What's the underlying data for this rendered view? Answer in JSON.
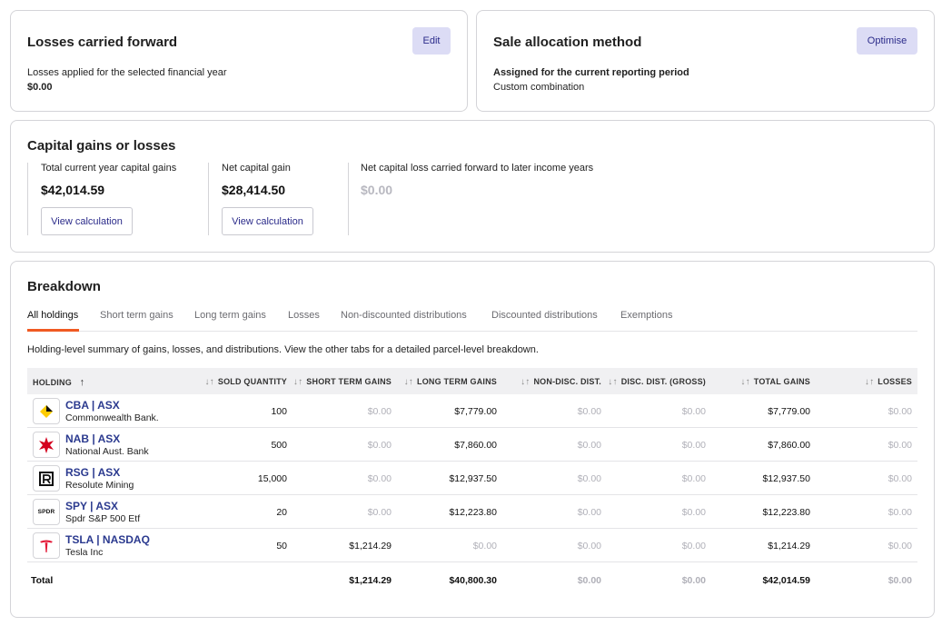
{
  "losses_card": {
    "title": "Losses carried forward",
    "edit_label": "Edit",
    "label": "Losses applied for the selected financial year",
    "value": "$0.00"
  },
  "allocation_card": {
    "title": "Sale allocation method",
    "optimise_label": "Optimise",
    "label": "Assigned for the current reporting period",
    "value": "Custom combination"
  },
  "capital_gains": {
    "title": "Capital gains or losses",
    "total": {
      "label": "Total current year capital gains",
      "value": "$42,014.59",
      "button": "View calculation"
    },
    "net": {
      "label": "Net capital gain",
      "value": "$28,414.50",
      "button": "View calculation"
    },
    "carried": {
      "label": "Net capital loss carried forward to later income years",
      "value": "$0.00"
    }
  },
  "breakdown": {
    "title": "Breakdown",
    "tabs": [
      "All holdings",
      "Short term gains",
      "Long term gains",
      "Losses",
      "Non-discounted distributions",
      "Discounted distributions",
      "Exemptions"
    ],
    "description": "Holding-level summary of gains, losses, and distributions. View the other tabs for a detailed parcel-level breakdown.",
    "columns": [
      "HOLDING",
      "SOLD QUANTITY",
      "SHORT TERM GAINS",
      "LONG TERM GAINS",
      "NON-DISC. DIST.",
      "DISC. DIST. (GROSS)",
      "TOTAL GAINS",
      "LOSSES"
    ],
    "sort_icons": {
      "holding": "↑",
      "other": "↓↑"
    },
    "rows": [
      {
        "ticker": "CBA | ASX",
        "name": "Commonwealth Bank.",
        "logo": "cba-logo",
        "qty": "100",
        "short": "$0.00",
        "long": "$7,779.00",
        "nondisc": "$0.00",
        "disc": "$0.00",
        "total": "$7,779.00",
        "losses": "$0.00"
      },
      {
        "ticker": "NAB | ASX",
        "name": "National Aust. Bank",
        "logo": "nab-logo",
        "qty": "500",
        "short": "$0.00",
        "long": "$7,860.00",
        "nondisc": "$0.00",
        "disc": "$0.00",
        "total": "$7,860.00",
        "losses": "$0.00"
      },
      {
        "ticker": "RSG | ASX",
        "name": "Resolute Mining",
        "logo": "rsg-logo",
        "qty": "15,000",
        "short": "$0.00",
        "long": "$12,937.50",
        "nondisc": "$0.00",
        "disc": "$0.00",
        "total": "$12,937.50",
        "losses": "$0.00"
      },
      {
        "ticker": "SPY | ASX",
        "name": "Spdr S&P 500 Etf",
        "logo": "spdr-logo",
        "logo_text": "SPDR",
        "qty": "20",
        "short": "$0.00",
        "long": "$12,223.80",
        "nondisc": "$0.00",
        "disc": "$0.00",
        "total": "$12,223.80",
        "losses": "$0.00"
      },
      {
        "ticker": "TSLA | NASDAQ",
        "name": "Tesla Inc",
        "logo": "tesla-logo",
        "qty": "50",
        "short": "$1,214.29",
        "long": "$0.00",
        "nondisc": "$0.00",
        "disc": "$0.00",
        "total": "$1,214.29",
        "losses": "$0.00"
      }
    ],
    "total": {
      "label": "Total",
      "short": "$1,214.29",
      "long": "$40,800.30",
      "nondisc": "$0.00",
      "disc": "$0.00",
      "total": "$42,014.59",
      "losses": "$0.00"
    }
  },
  "colors": {
    "accent": "#f05a22",
    "link": "#2b3a8f",
    "button_bg": "#dcdcf5"
  }
}
